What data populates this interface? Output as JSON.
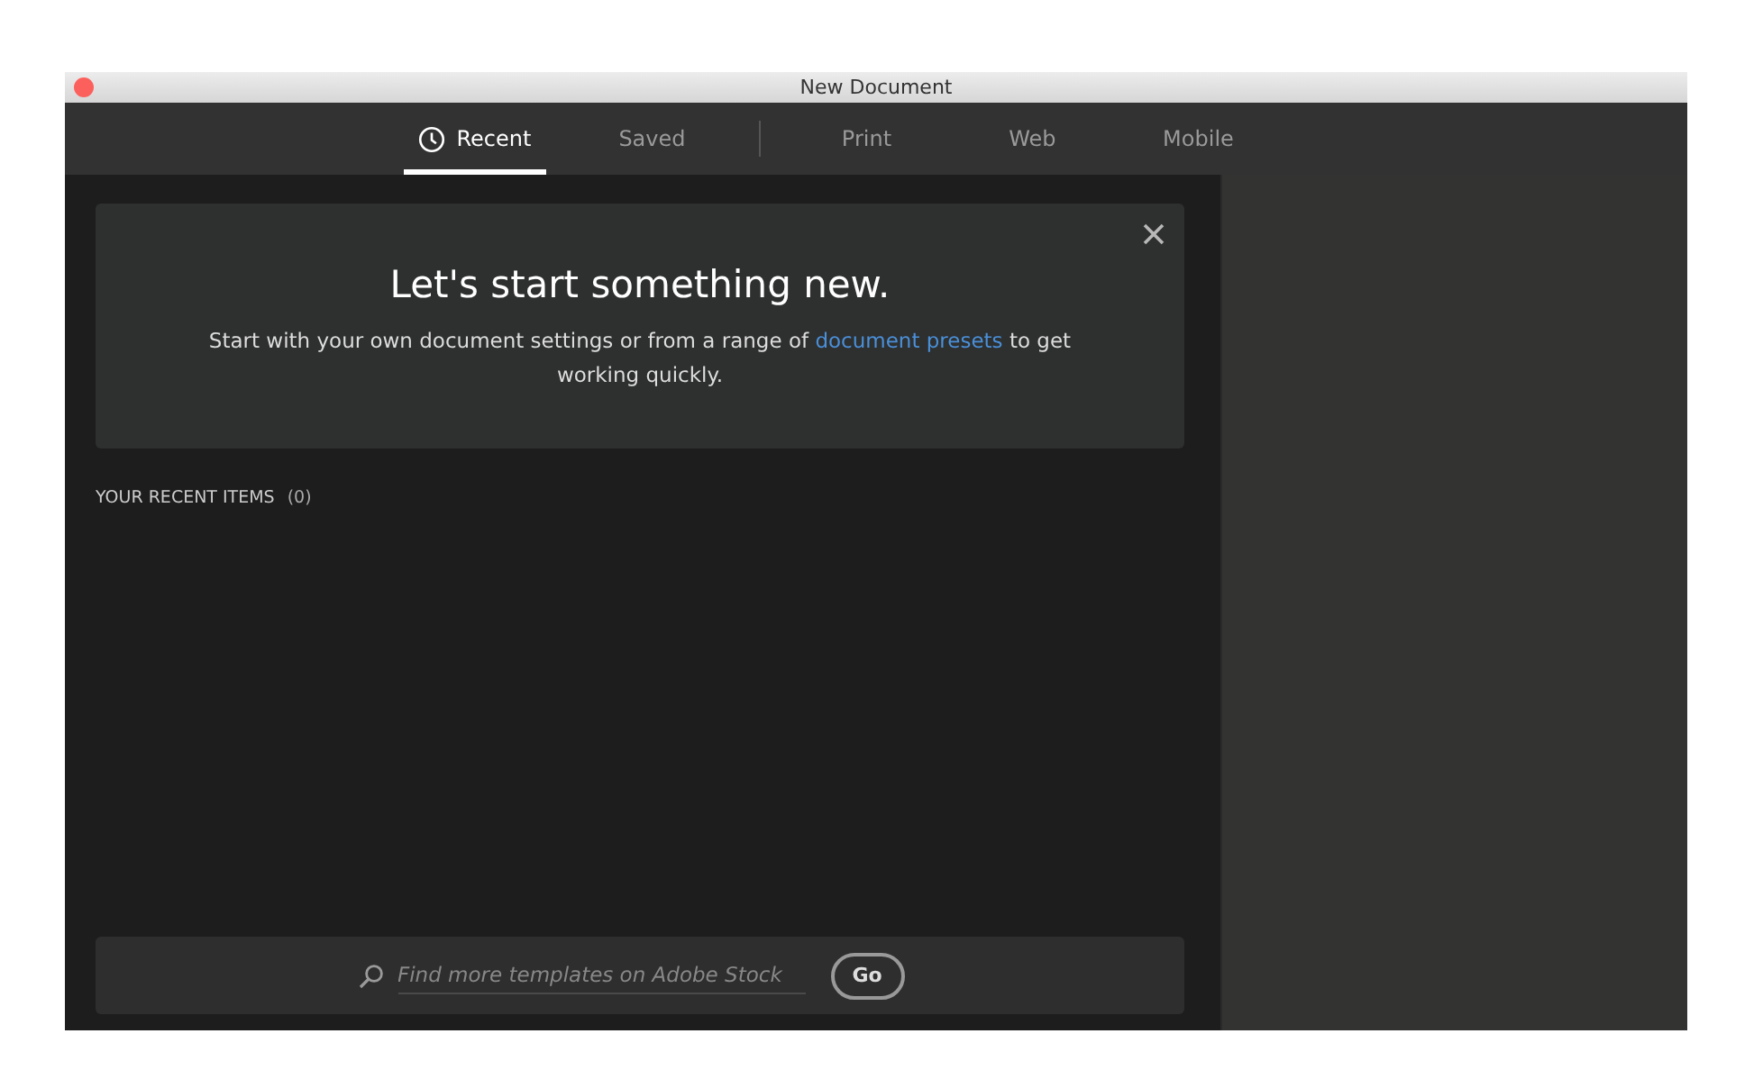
{
  "window": {
    "title": "New Document"
  },
  "tab_groups": [
    [
      {
        "label": "Recent",
        "selected": true,
        "kind": "clock"
      },
      {
        "label": "Saved",
        "selected": false,
        "kind": "text"
      }
    ],
    [
      {
        "label": "Print",
        "selected": false,
        "kind": "text"
      },
      {
        "label": "Web",
        "selected": false,
        "kind": "text"
      },
      {
        "label": "Mobile",
        "selected": false,
        "kind": "text"
      }
    ]
  ],
  "welcome": {
    "title": "Let's start something new.",
    "text_before": "Start with your own document settings or from a range of",
    "link": "document presets",
    "text_after": "to get working quickly."
  },
  "recent": {
    "heading": "YOUR RECENT ITEMS",
    "count": "(0)"
  },
  "stock_search": {
    "placeholder": "Find more templates on Adobe Stock",
    "button": "Go"
  }
}
